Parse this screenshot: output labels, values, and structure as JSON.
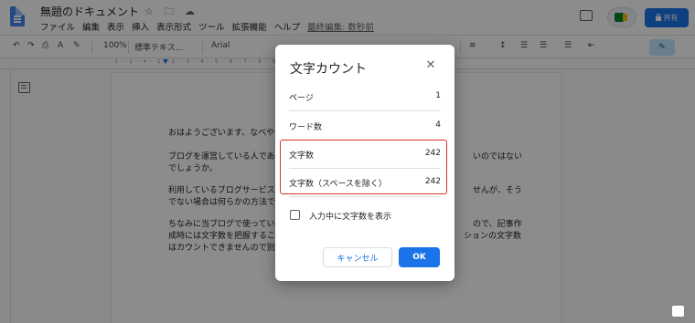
{
  "header": {
    "doc_title": "無題のドキュメント",
    "title_icons": "☆ 🗀 ☁",
    "menu": [
      "ファイル",
      "編集",
      "表示",
      "挿入",
      "表示形式",
      "ツール",
      "拡張機能",
      "ヘルプ"
    ],
    "last_edit": "最終編集: 数秒前",
    "share_label": "共有"
  },
  "toolbar": {
    "undo": "↶",
    "redo": "↷",
    "print": "⎙",
    "spell": "A",
    "paint": "✎",
    "zoom": "100%",
    "style": "標準テキス...",
    "font": "Arial",
    "align": "≡",
    "line_spacing": "↕",
    "checklist": "☰",
    "bullets": "☰",
    "numbered": "☰",
    "indent": "⇤",
    "pen": "✎"
  },
  "ruler": {
    "numbers": "· 2 · · · 1 · · · ▾ · · · 1 · · · 2 · · · 3 · · · 4 · · · 5 · · · 6 · · · 7 · · · 8 · · · 9 · · · 10 · · · 11 · · · 12 · · · 13 · · · 14 · · · 15 · · · 16 · · · 17 · · · 18 ·"
  },
  "document": {
    "line1": "おはようございます、なべや",
    "line2a": "ブログを運営している人であ",
    "line2b": "いのではない",
    "line3": "でしょうか。",
    "line4a": "利用しているブログサービス",
    "line4b": "せんが、そう",
    "line5": "でない場合は何らかの方法で",
    "line6a": "ちなみに当ブログで使ってい",
    "line6b": "ので、記事作",
    "line7a": "成時には文字数を把握するこ",
    "line7b": "ションの文字数",
    "line8": "はカウントできませんので別"
  },
  "dialog": {
    "title": "文字カウント",
    "rows": [
      {
        "label": "ページ",
        "value": "1"
      },
      {
        "label": "ワード数",
        "value": "4"
      },
      {
        "label": "文字数",
        "value": "242"
      },
      {
        "label": "文字数（スペースを除く）",
        "value": "242"
      }
    ],
    "checkbox_label": "入力中に文字数を表示",
    "cancel_label": "キャンセル",
    "ok_label": "OK"
  },
  "colors": {
    "accent": "#1a73e8",
    "highlight_border": "#d93025"
  }
}
